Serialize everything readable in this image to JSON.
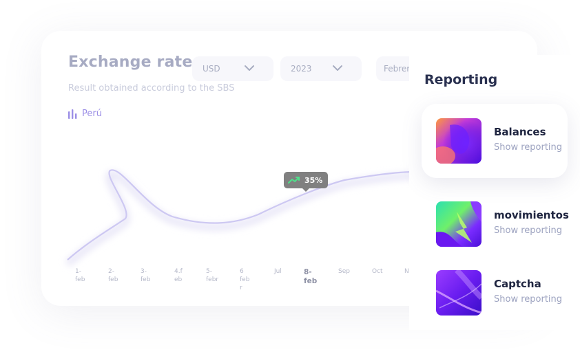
{
  "chart": {
    "title": "Exchange rate",
    "subtitle": "Result obtained according to the SBS",
    "country": "Perú",
    "filters": {
      "currency": "USD",
      "year": "2023",
      "month": "Febrer"
    },
    "tooltip": "35%",
    "x_labels": [
      "1-\nfeb",
      "2-\nfeb",
      "3-\nfeb",
      "4.f\neb",
      "5-\nfebr",
      "6\nfeb\nr",
      "Jul",
      "8-\nfeb",
      "Sep",
      "Oct",
      "N"
    ],
    "active_label_index": 7
  },
  "chart_data": {
    "type": "line",
    "categories": [
      "1-feb",
      "2-feb",
      "3-feb",
      "4.feb",
      "5-febr",
      "6 febr",
      "Jul",
      "8-feb",
      "Sep",
      "Oct",
      "N"
    ],
    "series": [
      {
        "values": []
      }
    ],
    "grid": false
  },
  "reporting": {
    "title": "Reporting",
    "items": [
      {
        "name": "Balances",
        "link": "Show reporting"
      },
      {
        "name": "movimientos",
        "link": "Show reporting"
      },
      {
        "name": "Captcha",
        "link": "Show reporting"
      }
    ]
  },
  "colors": {
    "accent": "#9c8fe6",
    "title": "#2a3150",
    "muted": "#a7abc3",
    "curve": "#c9c3f1"
  }
}
